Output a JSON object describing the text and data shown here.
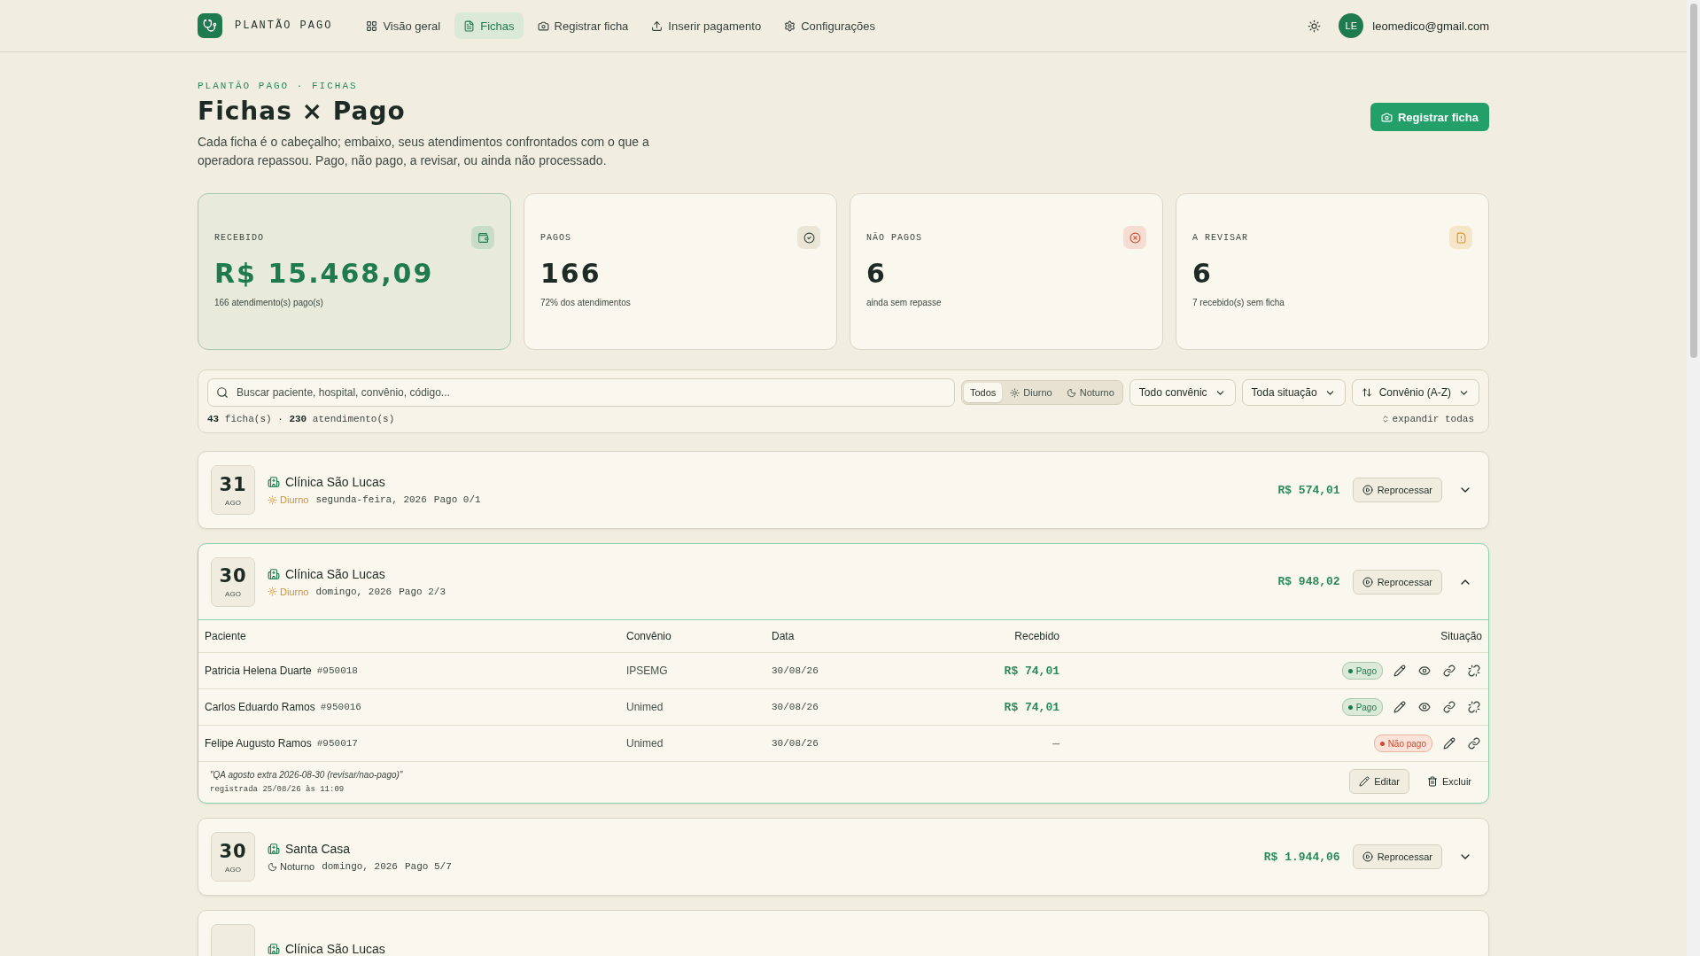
{
  "nav": {
    "brand": "PLANTÃO PAGO",
    "items": [
      {
        "label": "Visão geral",
        "kind": "overview",
        "selected": false
      },
      {
        "label": "Fichas",
        "kind": "sheets",
        "selected": true
      },
      {
        "label": "Registrar ficha",
        "kind": "camera",
        "selected": false
      },
      {
        "label": "Inserir pagamento",
        "kind": "upload",
        "selected": false
      },
      {
        "label": "Configurações",
        "kind": "settings",
        "selected": false
      }
    ],
    "user": {
      "initials": "LE",
      "email": "leomedico@gmail.com"
    }
  },
  "header": {
    "breadcrumb": "PLANTÃO PAGO · FICHAS",
    "title": "Fichas × Pago",
    "description": "Cada ficha é o cabeçalho; embaixo, seus atendimentos confrontados com o que a operadora repassou. Pago, não pago, a revisar, ou ainda não processado.",
    "button": "Registrar ficha"
  },
  "stats": [
    {
      "kind": "received",
      "label": "RECEBIDO",
      "value": "R$ 15.468,09",
      "sub": "166 atendimento(s) pago(s)"
    },
    {
      "kind": "paid",
      "label": "PAGOS",
      "value": "166",
      "sub": "72% dos atendimentos"
    },
    {
      "kind": "unpaid",
      "label": "NÃO PAGOS",
      "value": "6",
      "sub": "ainda sem repasse"
    },
    {
      "kind": "review",
      "label": "A REVISAR",
      "value": "6",
      "sub": "7 recebido(s) sem ficha"
    }
  ],
  "filters": {
    "placeholder": "Buscar paciente, hospital, convênio, código...",
    "shifts": [
      {
        "label": "Todos",
        "kind": "all",
        "selected": true
      },
      {
        "label": "Diurno",
        "kind": "day",
        "selected": false
      },
      {
        "label": "Noturno",
        "kind": "night",
        "selected": false
      }
    ],
    "selects": [
      {
        "label": "Todo convênic",
        "kind": "plain"
      },
      {
        "label": "Toda situação",
        "kind": "plain"
      },
      {
        "label": "Convênio (A-Z)",
        "kind": "sort"
      }
    ],
    "summary": "**43** ficha(s) · **230** atendimento(s)",
    "expand_all": "expandir todas"
  },
  "fichas": [
    {
      "day": "31",
      "month": "AGO",
      "hospital": "Clínica São Lucas",
      "shift": {
        "kind": "day",
        "label": "Diurno"
      },
      "date": "segunda-feira, 2026",
      "paid": "Pago 0/1",
      "amount": "R$ 574,01",
      "action": "Reprocessar",
      "expanded": false
    },
    {
      "day": "30",
      "month": "AGO",
      "hospital": "Clínica São Lucas",
      "shift": {
        "kind": "day",
        "label": "Diurno"
      },
      "date": "domingo, 2026",
      "paid": "Pago 2/3",
      "amount": "R$ 948,02",
      "action": "Reprocessar",
      "expanded": true,
      "columns": [
        "Paciente",
        "Convênio",
        "Data",
        "Recebido",
        "Situação"
      ],
      "rows": [
        {
          "patient": "Patricia Helena Duarte",
          "code": "#950018",
          "plan": "IPSEMG",
          "date": "30/08/26",
          "received": "R$ 74,01",
          "status": {
            "kind": "paid",
            "label": "Pago"
          }
        },
        {
          "patient": "Carlos Eduardo Ramos",
          "code": "#950016",
          "plan": "Unimed",
          "date": "30/08/26",
          "received": "R$ 74,01",
          "status": {
            "kind": "paid",
            "label": "Pago"
          }
        },
        {
          "patient": "Felipe Augusto Ramos",
          "code": "#950017",
          "plan": "Unimed",
          "date": "30/08/26",
          "received": "—",
          "status": {
            "kind": "unpaid",
            "label": "Não pago"
          }
        }
      ],
      "note": "\"QA agosto extra 2026-08-30 (revisar/nao-pago)\"",
      "registered": "registrada 25/08/26 às 11:09",
      "edit": "Editar",
      "delete": "Excluir"
    },
    {
      "day": "30",
      "month": "AGO",
      "hospital": "Santa Casa",
      "shift": {
        "kind": "night",
        "label": "Noturno"
      },
      "date": "domingo, 2026",
      "paid": "Pago 5/7",
      "amount": "R$ 1.944,06",
      "action": "Reprocessar",
      "expanded": false
    },
    {
      "hospital": "Clínica São Lucas",
      "expanded": false
    }
  ]
}
